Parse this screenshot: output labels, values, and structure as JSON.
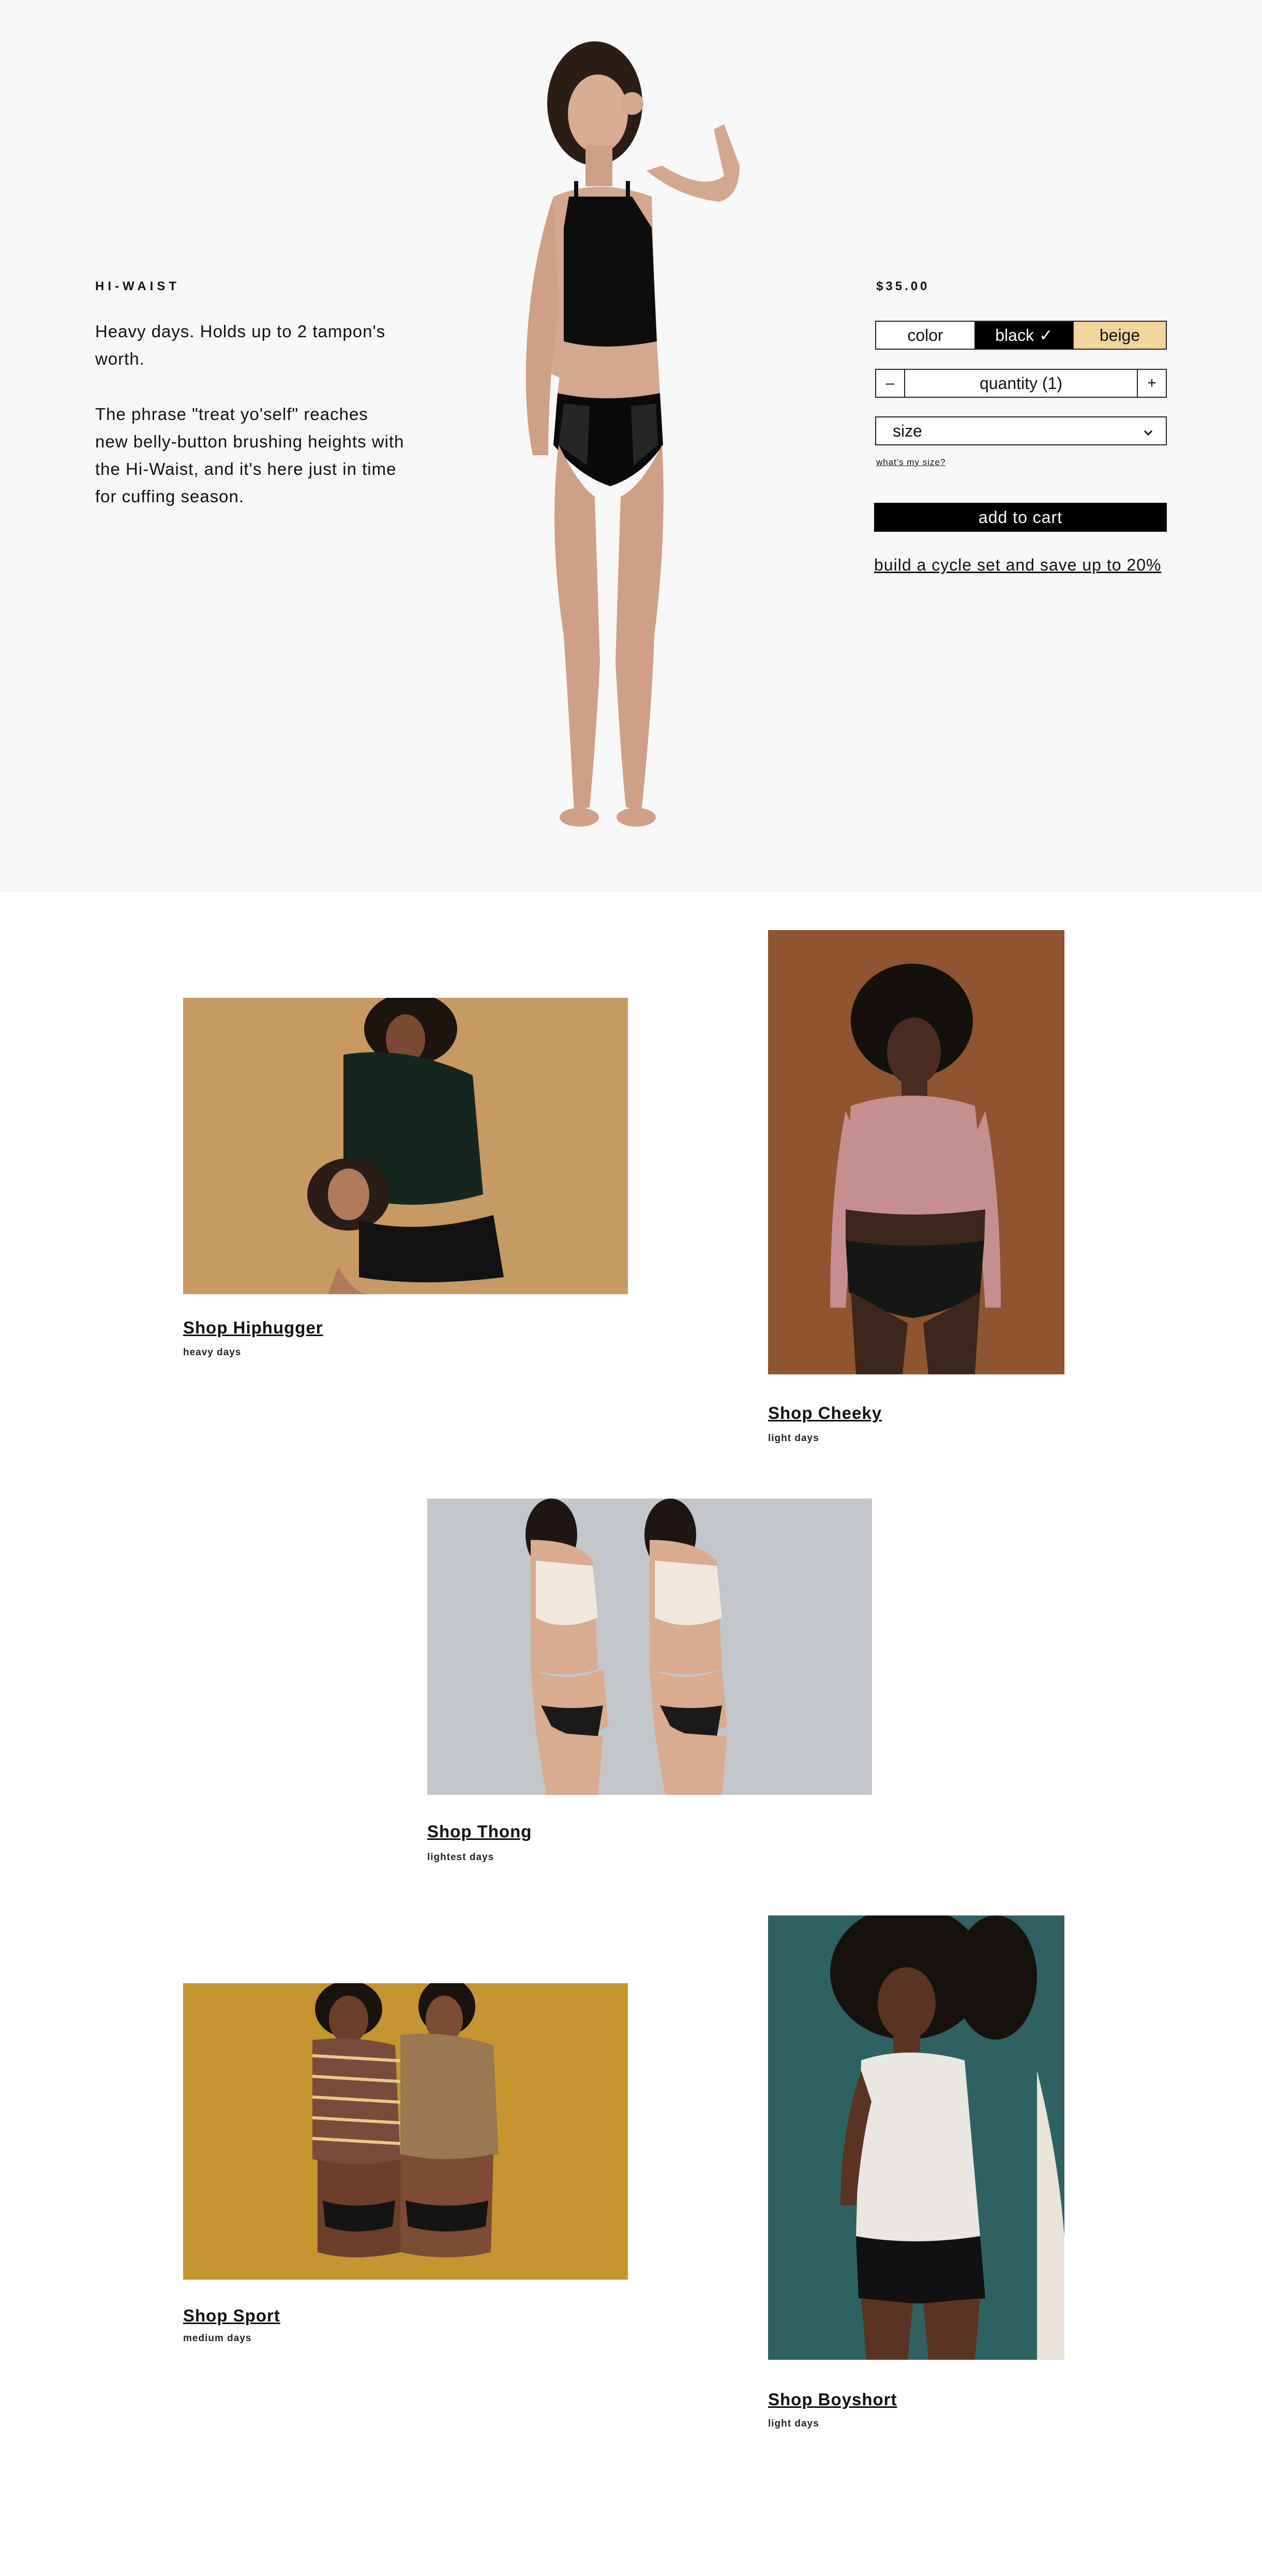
{
  "product": {
    "name": "HI-WAIST",
    "description": [
      "Heavy days. Holds up to 2 tampon's worth.",
      "The phrase \"treat yo'self\" reaches new belly-button brushing heights with the Hi-Waist, and it's here just in time for cuffing season."
    ],
    "price": "$35.00"
  },
  "options": {
    "color_label": "color",
    "colors": [
      {
        "label": "black",
        "selected": true,
        "swatch": "#000000"
      },
      {
        "label": "beige",
        "selected": false,
        "swatch": "#f3d49b"
      }
    ],
    "check_glyph": "✓",
    "quantity_minus": "–",
    "quantity_label": "quantity (1)",
    "quantity_plus": "+",
    "size_label": "size",
    "size_chevron_icon": "chevron-down-icon",
    "size_link": "what's my size?"
  },
  "actions": {
    "add_to_cart": "add to cart",
    "cycle_set": "build a cycle set and save up to 20%"
  },
  "shop": {
    "tiles": [
      {
        "link": "Shop Hiphugger",
        "sub": "heavy days",
        "bg": "#c79a63"
      },
      {
        "link": "Shop Cheeky",
        "sub": "light days",
        "bg": "#8e5530"
      },
      {
        "link": "Shop Thong",
        "sub": "lightest days",
        "bg": "#c3c6ca"
      },
      {
        "link": "Shop Sport",
        "sub": "medium days",
        "bg": "#c59530"
      },
      {
        "link": "Shop Boyshort",
        "sub": "light days",
        "bg": "#2f6163"
      }
    ]
  }
}
